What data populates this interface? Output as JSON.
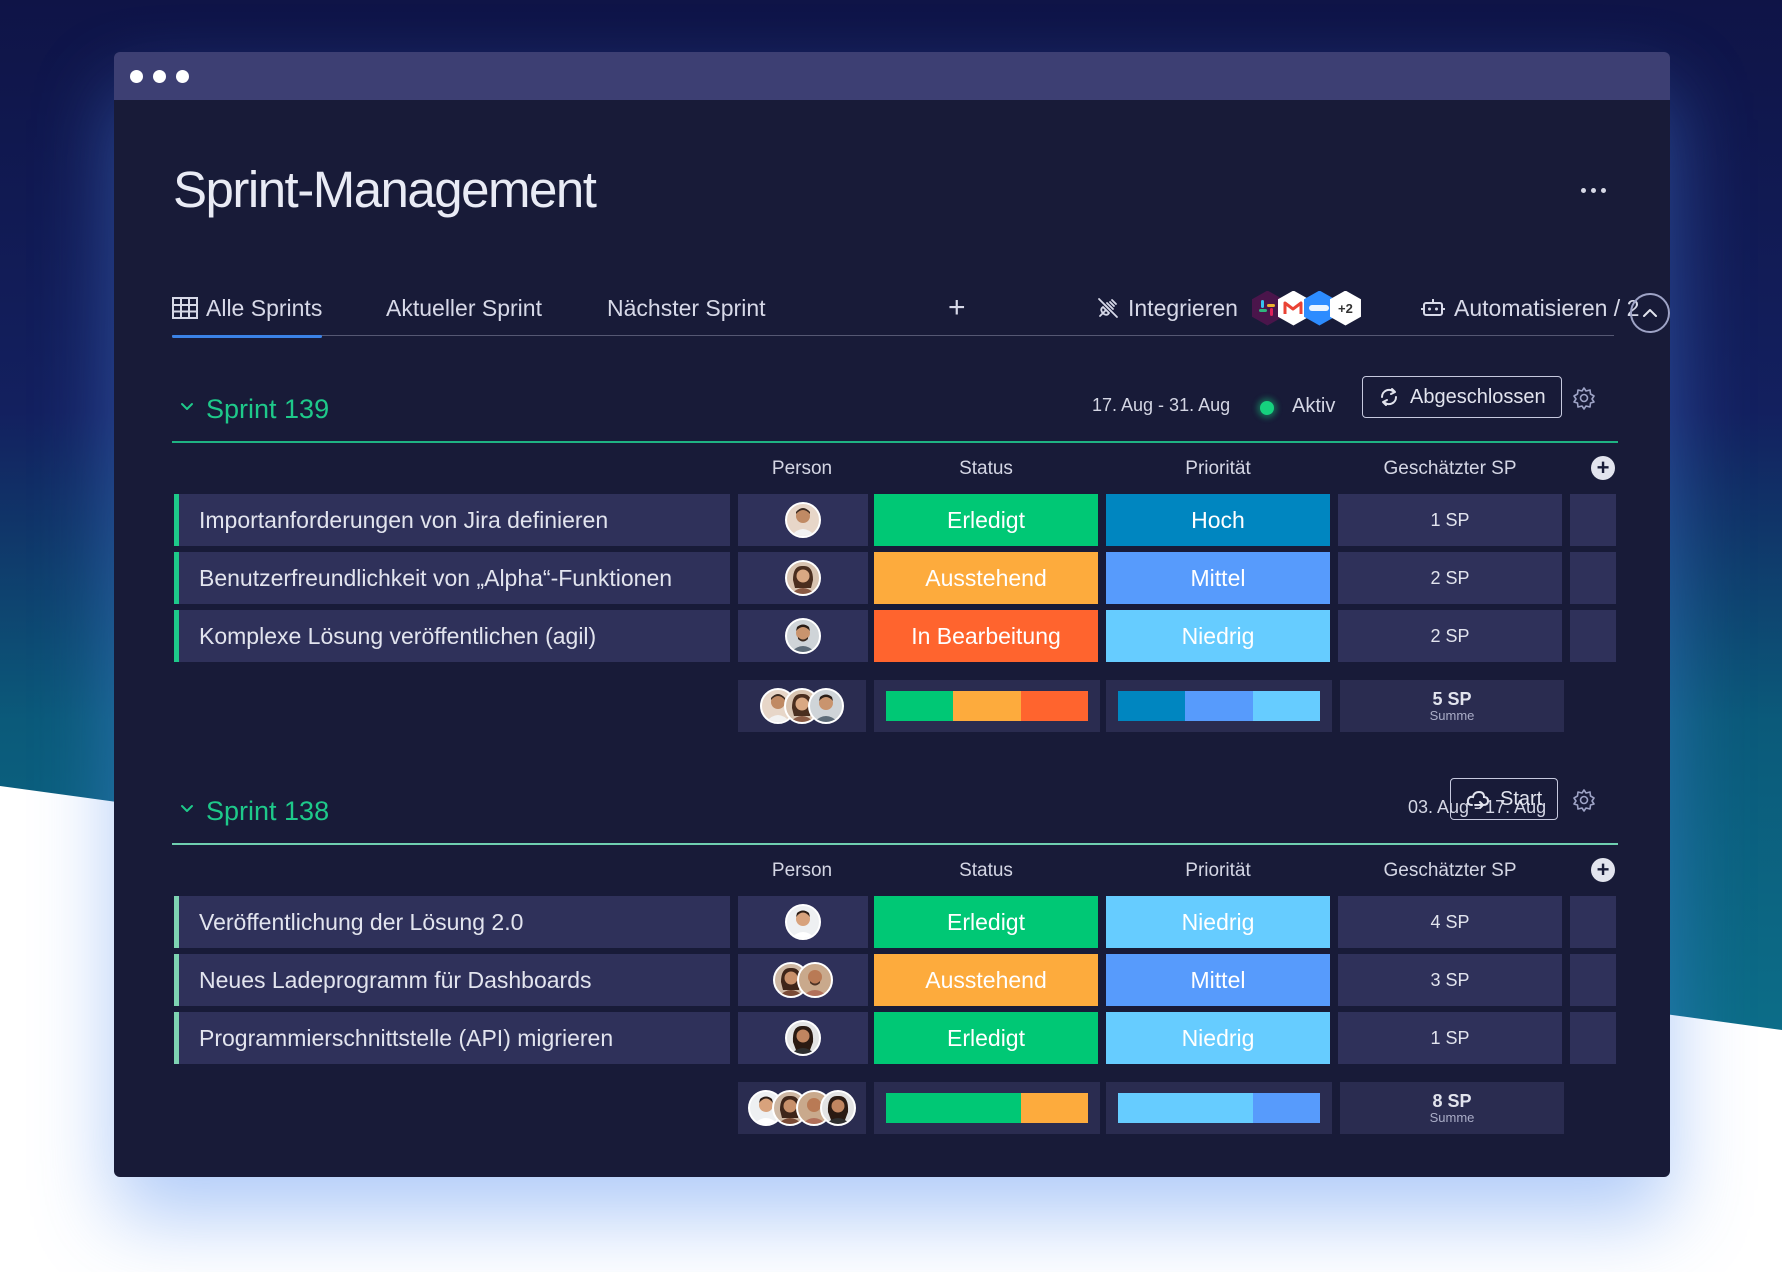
{
  "app": {
    "title": "Sprint-Management"
  },
  "tabs": {
    "items": [
      {
        "label": "Alle Sprints"
      },
      {
        "label": "Aktueller Sprint"
      },
      {
        "label": "Nächster Sprint"
      }
    ],
    "add_label": "+",
    "integrate_label": "Integrieren",
    "integrations": [
      "slack",
      "gmail",
      "zoom"
    ],
    "integrations_more": "+2",
    "automate_label": "Automatisieren / 2"
  },
  "columns": {
    "person": "Person",
    "status": "Status",
    "priority": "Priorität",
    "sp": "Geschätzter SP"
  },
  "colors": {
    "done": "#00c875",
    "pending": "#fdab3d",
    "in_progress": "#ff642e",
    "high": "#0086c0",
    "medium": "#579bfc",
    "low": "#66ccff",
    "accent_green": "#1ec98a"
  },
  "groups": [
    {
      "name": "Sprint 139",
      "daterange": "17. Aug - 31. Aug",
      "state_label": "Aktiv",
      "action_label": "Abgeschlossen",
      "rows": [
        {
          "task": "Importanforderungen von Jira definieren",
          "status": "Erledigt",
          "status_color": "#00c875",
          "priority": "Hoch",
          "priority_color": "#0086c0",
          "sp": "1 SP"
        },
        {
          "task": "Benutzerfreundlichkeit von „Alpha“-Funktionen",
          "status": "Ausstehend",
          "status_color": "#fdab3d",
          "priority": "Mittel",
          "priority_color": "#579bfc",
          "sp": "2 SP"
        },
        {
          "task": "Komplexe Lösung veröffentlichen (agil)",
          "status": "In Bearbeitung",
          "status_color": "#ff642e",
          "priority": "Niedrig",
          "priority_color": "#66ccff",
          "sp": "2 SP"
        }
      ],
      "summary": {
        "status_shares": [
          0.33,
          0.34,
          0.33
        ],
        "status_colors": [
          "#00c875",
          "#fdab3d",
          "#ff642e"
        ],
        "priority_shares": [
          0.33,
          0.34,
          0.33
        ],
        "priority_colors": [
          "#0086c0",
          "#579bfc",
          "#66ccff"
        ],
        "sp_total": "5 SP",
        "sp_label": "Summe"
      }
    },
    {
      "name": "Sprint 138",
      "daterange": "03. Aug - 17. Aug",
      "action_label": "Start",
      "rows": [
        {
          "task": "Veröffentlichung der Lösung 2.0",
          "status": "Erledigt",
          "status_color": "#00c875",
          "priority": "Niedrig",
          "priority_color": "#66ccff",
          "sp": "4 SP"
        },
        {
          "task": "Neues Ladeprogramm für Dashboards",
          "status": "Ausstehend",
          "status_color": "#fdab3d",
          "priority": "Mittel",
          "priority_color": "#579bfc",
          "sp": "3 SP"
        },
        {
          "task": "Programmierschnittstelle (API) migrieren",
          "status": "Erledigt",
          "status_color": "#00c875",
          "priority": "Niedrig",
          "priority_color": "#66ccff",
          "sp": "1 SP"
        }
      ],
      "summary": {
        "status_shares": [
          0.67,
          0.33
        ],
        "status_colors": [
          "#00c875",
          "#fdab3d"
        ],
        "priority_shares": [
          0.67,
          0.33
        ],
        "priority_colors": [
          "#66ccff",
          "#579bfc"
        ],
        "sp_total": "8 SP",
        "sp_label": "Summe"
      }
    }
  ]
}
